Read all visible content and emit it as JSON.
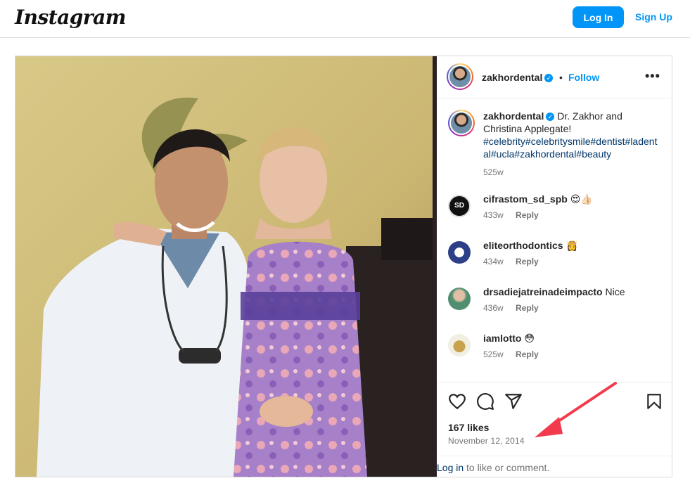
{
  "header": {
    "logo_text": "Instagram",
    "login_label": "Log In",
    "signup_label": "Sign Up"
  },
  "post": {
    "author": "zakhordental",
    "follow_label": "Follow",
    "separator": "•",
    "more_glyph": "•••",
    "caption": {
      "text": "Dr. Zakhor and Christina Applegate!",
      "hashtags": "#celebrity#celebritysmile#dentist#ladental#ucla#zakhordental#beauty",
      "age": "525w"
    },
    "comments": [
      {
        "user": "cifrastom_sd_spb",
        "text": "😍👍🏻",
        "age": "433w",
        "reply": "Reply",
        "avatar_label": "SD"
      },
      {
        "user": "eliteorthodontics",
        "text": "👸",
        "age": "434w",
        "reply": "Reply"
      },
      {
        "user": "drsadiejatreinadeimpacto",
        "text": "Nice",
        "age": "436w",
        "reply": "Reply"
      },
      {
        "user": "iamlotto",
        "text": "😳",
        "age": "525w",
        "reply": "Reply"
      }
    ],
    "likes": "167 likes",
    "date": "November 12, 2014",
    "login_prompt": {
      "link": "Log in",
      "rest": " to like or comment."
    }
  },
  "icons": [
    "heart-icon",
    "comment-icon",
    "share-icon",
    "bookmark-icon",
    "verified-badge-icon",
    "more-options-icon"
  ],
  "colors": {
    "primary_blue": "#0095f6",
    "hashtag_blue": "#00376b",
    "muted_text": "#737373",
    "annotation_arrow": "#f23a4c"
  }
}
